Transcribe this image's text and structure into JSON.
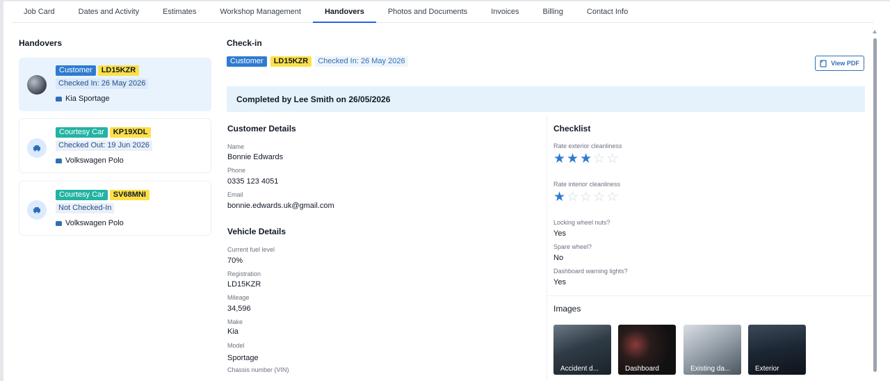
{
  "tabs": [
    {
      "label": "Job Card"
    },
    {
      "label": "Dates and Activity"
    },
    {
      "label": "Estimates"
    },
    {
      "label": "Workshop Management"
    },
    {
      "label": "Handovers"
    },
    {
      "label": "Photos and Documents"
    },
    {
      "label": "Invoices"
    },
    {
      "label": "Billing"
    },
    {
      "label": "Contact Info"
    }
  ],
  "active_tab": "Handovers",
  "handovers": {
    "title": "Handovers",
    "items": [
      {
        "type": "Customer",
        "plate": "LD15KZR",
        "status": "Checked In: 26 May 2026",
        "vehicle": "Kia Sportage",
        "icon": "vehicle-photo"
      },
      {
        "type": "Courtesy Car",
        "plate": "KP19XDL",
        "status": "Checked Out: 19 Jun 2026",
        "vehicle": "Volkswagen Polo",
        "icon": "car-icon"
      },
      {
        "type": "Courtesy Car",
        "plate": "SV68MNI",
        "status": "Not Checked-In",
        "vehicle": "Volkswagen Polo",
        "icon": "car-icon"
      }
    ]
  },
  "detail": {
    "title": "Check-in",
    "type_badge": "Customer",
    "plate_badge": "LD15KZR",
    "checked_in": "Checked In: 26 May 2026",
    "view_pdf": "View PDF",
    "completed": "Completed by Lee Smith on 26/05/2026",
    "customer": {
      "title": "Customer Details",
      "name_label": "Name",
      "name": "Bonnie Edwards",
      "phone_label": "Phone",
      "phone": "0335 123 4051",
      "email_label": "Email",
      "email": "bonnie.edwards.uk@gmail.com"
    },
    "vehicle": {
      "title": "Vehicle Details",
      "fuel_label": "Current fuel level",
      "fuel": "70%",
      "reg_label": "Registration",
      "reg": "LD15KZR",
      "mileage_label": "Mileage",
      "mileage": "34,596",
      "make_label": "Make",
      "make": "Kia",
      "model_label": "Model",
      "model": "Sportage",
      "vin_label": "Chassis number (VIN)"
    },
    "checklist": {
      "title": "Checklist",
      "exterior_label": "Rate exterior cleanliness",
      "exterior_rating": 3,
      "interior_label": "Rate interior cleanliness",
      "interior_rating": 1,
      "rating_max": 5,
      "locking_label": "Locking wheel nuts?",
      "locking": "Yes",
      "spare_label": "Spare wheel?",
      "spare": "No",
      "dash_label": "Dashboard warning lights?",
      "dash": "Yes"
    },
    "images": {
      "title": "Images",
      "items": [
        {
          "caption": "Accident d..."
        },
        {
          "caption": "Dashboard"
        },
        {
          "caption": "Existing da..."
        },
        {
          "caption": "Exterior"
        }
      ]
    }
  },
  "colors": {
    "accent": "#2563eb",
    "customer_badge": "#2f7bd0",
    "courtesy_badge": "#22b3a3",
    "plate_badge": "#fde047",
    "star": "#2f7bd0"
  }
}
